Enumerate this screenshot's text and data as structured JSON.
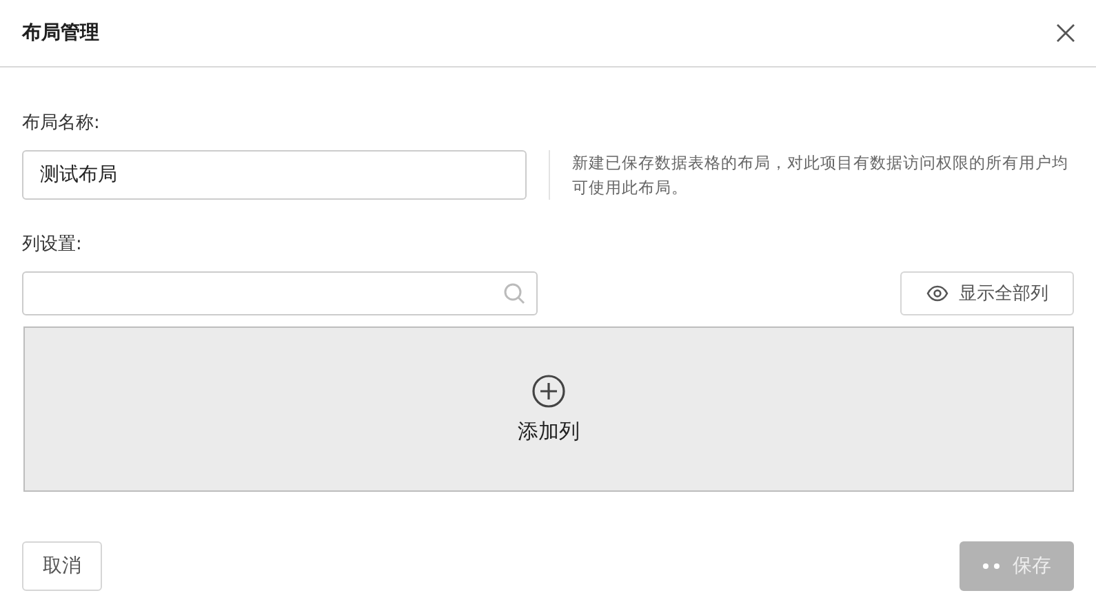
{
  "dialog": {
    "title": "布局管理"
  },
  "name_field": {
    "label": "布局名称:",
    "value": "测试布局"
  },
  "help_text": "新建已保存数据表格的布局，对此项目有数据访问权限的所有用户均可使用此布局。",
  "columns": {
    "label": "列设置:",
    "show_all_button": "显示全部列",
    "add_label": "添加列"
  },
  "cancel_button": {
    "label": "取消"
  },
  "save_button": {
    "label": "保存",
    "disabled": true,
    "loading": true
  }
}
